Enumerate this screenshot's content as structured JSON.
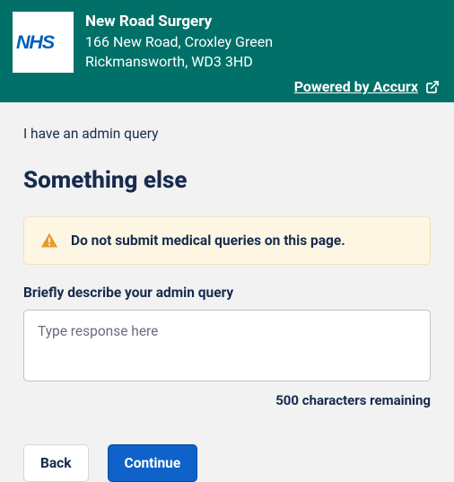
{
  "header": {
    "practice_name": "New Road Surgery",
    "address_line1": "166 New Road, Croxley Green",
    "address_line2": "Rickmansworth, WD3 3HD",
    "powered_by": "Powered by Accurx"
  },
  "breadcrumb": "I have an admin query",
  "page_title": "Something else",
  "warning": {
    "text": "Do not submit medical queries on this page."
  },
  "form": {
    "description_label": "Briefly describe your admin query",
    "description_placeholder": "Type response here",
    "char_remaining": "500 characters remaining"
  },
  "buttons": {
    "back": "Back",
    "continue": "Continue"
  }
}
